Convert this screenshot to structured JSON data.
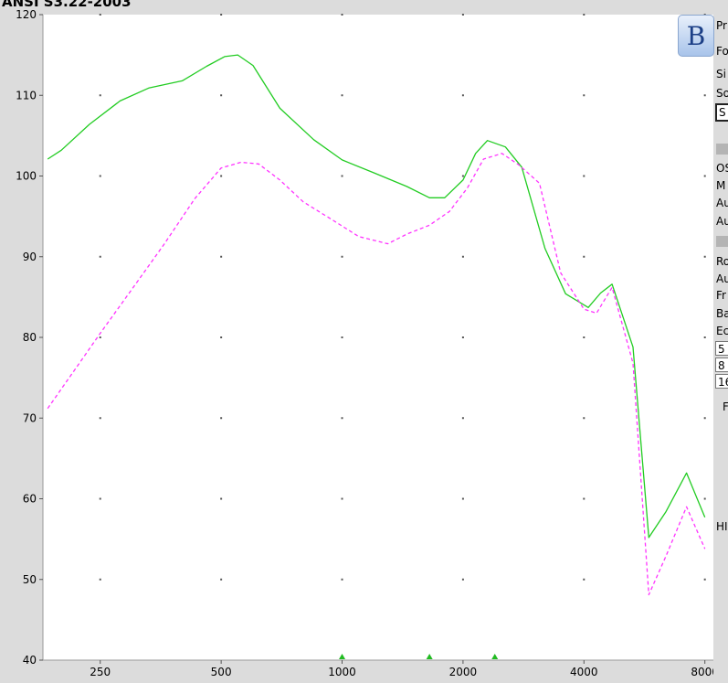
{
  "header": {
    "title": "ANSI S3.22-2003"
  },
  "badge": {
    "label": "B"
  },
  "side_panel": {
    "texts": [
      "Pr",
      "Fo",
      "Si",
      "So",
      "OS",
      "M",
      "Au",
      "Au",
      "Ro",
      "Au",
      "Fr",
      "Ba",
      "Ec",
      "HI"
    ],
    "boxes": [
      "S",
      "5",
      "8",
      "16"
    ],
    "trailing_mark": "F"
  },
  "chart_data": {
    "type": "line",
    "title": "",
    "xlabel": "",
    "ylabel": "",
    "x_scale": "log",
    "xlim": [
      180,
      8400
    ],
    "ylim": [
      40,
      120
    ],
    "grid": true,
    "x_ticks": [
      250,
      500,
      1000,
      2000,
      4000,
      8000
    ],
    "x_tick_labels": [
      "250",
      "500",
      "1000",
      "2000",
      "4000",
      "8000"
    ],
    "y_ticks": [
      40,
      50,
      60,
      70,
      80,
      90,
      100,
      110,
      120
    ],
    "y_tick_labels": [
      "40",
      "50",
      "60",
      "70",
      "80",
      "90",
      "100",
      "110",
      "120"
    ],
    "series": [
      {
        "color": "#22cc22",
        "style": "solid",
        "x": [
          185,
          200,
          235,
          280,
          330,
          400,
          460,
          510,
          550,
          600,
          700,
          850,
          1000,
          1200,
          1450,
          1650,
          1800,
          2000,
          2150,
          2300,
          2550,
          2800,
          3200,
          3600,
          4100,
          4400,
          4700,
          5300,
          5800,
          6400,
          7200,
          8000
        ],
        "y": [
          102.1,
          103.2,
          106.4,
          109.3,
          110.9,
          111.8,
          113.6,
          114.8,
          115.0,
          113.7,
          108.4,
          104.5,
          102.0,
          100.4,
          98.7,
          97.3,
          97.3,
          99.5,
          102.8,
          104.4,
          103.6,
          101.1,
          91.0,
          85.4,
          83.7,
          85.5,
          86.6,
          78.8,
          55.2,
          58.4,
          63.2,
          57.7
        ]
      },
      {
        "color": "#ff33ff",
        "style": "dashed",
        "x": [
          185,
          210,
          250,
          300,
          360,
          430,
          500,
          560,
          620,
          700,
          800,
          950,
          1100,
          1300,
          1450,
          1650,
          1850,
          2050,
          2250,
          2500,
          2750,
          3100,
          3500,
          4000,
          4300,
          4700,
          5300,
          5800,
          6400,
          7200,
          8000
        ],
        "y": [
          71.2,
          75.1,
          80.5,
          86.0,
          91.5,
          97.2,
          101.0,
          101.7,
          101.5,
          99.5,
          96.8,
          94.5,
          92.5,
          91.6,
          92.8,
          93.9,
          95.6,
          98.5,
          102.1,
          102.8,
          101.4,
          99.1,
          88.0,
          83.5,
          83.0,
          86.2,
          76.8,
          48.1,
          52.9,
          59.0,
          53.8
        ]
      }
    ],
    "markers": {
      "color": "#22bb22",
      "x": [
        1000,
        1650,
        2400
      ]
    }
  }
}
